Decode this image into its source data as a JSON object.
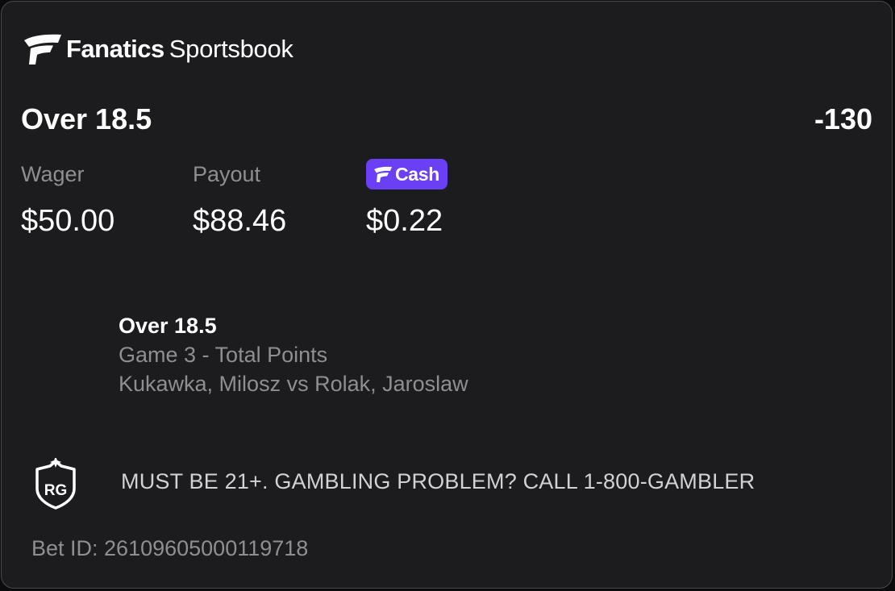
{
  "brand": {
    "name_bold": "Fanatics",
    "name_light": "Sportsbook"
  },
  "bet": {
    "title": "Over 18.5",
    "odds": "-130"
  },
  "stats": {
    "wager_label": "Wager",
    "wager_value": "$50.00",
    "payout_label": "Payout",
    "payout_value": "$88.46",
    "cash_badge_label": "Cash",
    "cash_value": "$0.22"
  },
  "leg": {
    "selection": "Over 18.5",
    "market": "Game 3 - Total Points",
    "event": "Kukawka, Milosz vs Rolak, Jaroslaw"
  },
  "responsible_gaming": {
    "icon": "rg-shield-icon",
    "icon_text": "RG",
    "message": "MUST BE 21+. GAMBLING PROBLEM? CALL 1-800-GAMBLER"
  },
  "footer": {
    "bet_id": "Bet ID: 26109605000119718"
  },
  "colors": {
    "card_bg": "#1c1c1e",
    "cash_accent": "#6a3ff5",
    "muted_text": "#8e8e93"
  }
}
